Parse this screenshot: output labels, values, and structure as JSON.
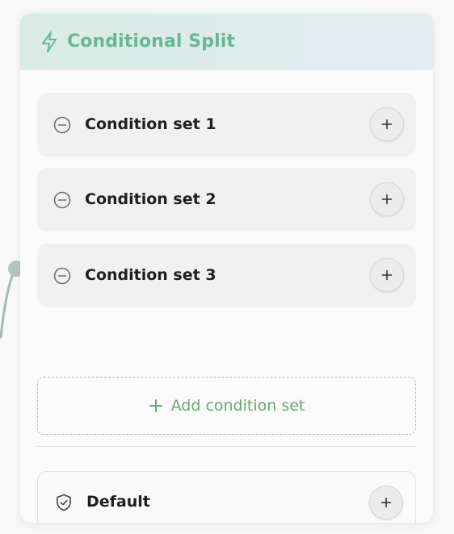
{
  "node": {
    "title": "Conditional Split",
    "icon": "bolt-icon",
    "accent_color": "#6ab796"
  },
  "condition_sets": [
    {
      "label": "Condition set 1",
      "remove_icon": "minus-circle-icon",
      "add_icon": "plus-icon"
    },
    {
      "label": "Condition set 2",
      "remove_icon": "minus-circle-icon",
      "add_icon": "plus-icon"
    },
    {
      "label": "Condition set 3",
      "remove_icon": "minus-circle-icon",
      "add_icon": "plus-icon"
    }
  ],
  "add_condition": {
    "label": "Add condition set",
    "color": "#6aa870"
  },
  "default_branch": {
    "label": "Default",
    "icon": "shield-check-icon"
  }
}
